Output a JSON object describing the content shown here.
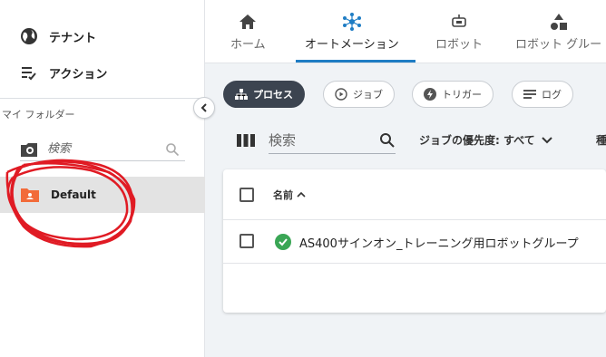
{
  "sidebar": {
    "tenant_label": "テナント",
    "actions_label": "アクション",
    "folders_heading": "マイ フォルダー",
    "search_placeholder": "検索",
    "folder_default": "Default"
  },
  "topnav": {
    "tabs": [
      {
        "label": "ホーム",
        "icon": "home-icon"
      },
      {
        "label": "オートメーション",
        "icon": "automation-icon",
        "active": true
      },
      {
        "label": "ロボット",
        "icon": "robot-icon"
      },
      {
        "label": "ロボット グルー",
        "icon": "robot-groups-icon"
      }
    ]
  },
  "main": {
    "chips": [
      {
        "label": "プロセス",
        "active": true
      },
      {
        "label": "ジョブ"
      },
      {
        "label": "トリガー"
      },
      {
        "label": "ログ"
      }
    ],
    "search_placeholder": "検索",
    "priority_filter": "ジョブの優先度: すべて",
    "next_filter_fragment": "種",
    "table": {
      "col_name": "名前",
      "rows": [
        {
          "name": "AS400サインオン_トレーニング用ロボットグループ",
          "status": "success"
        }
      ]
    }
  },
  "colors": {
    "accent": "#1f7dc4",
    "chip_active": "#3c4450",
    "folder_orange": "#f26b3a",
    "success_green": "#3aa655",
    "annotation_red": "#e01b24"
  }
}
